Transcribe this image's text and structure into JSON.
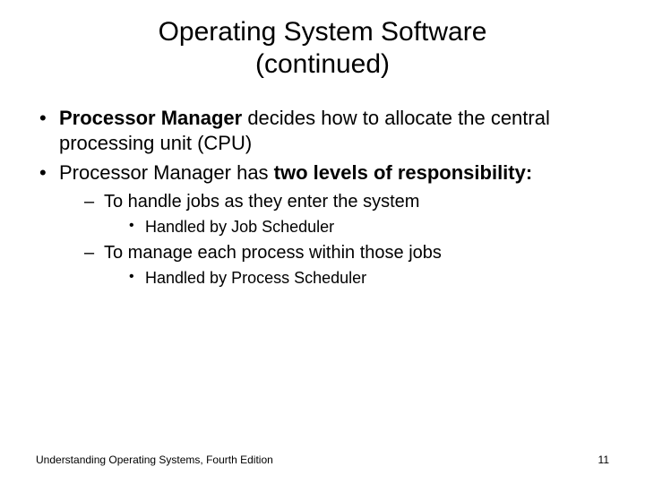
{
  "title_line1": "Operating System Software",
  "title_line2": "(continued)",
  "bullets": {
    "b1_bold": "Processor Manager",
    "b1_rest": " decides how to allocate the central processing unit (CPU)",
    "b2_pre": "Processor Manager has ",
    "b2_bold": "two levels of responsibility:",
    "b2_sub1": "To handle jobs as they enter the system",
    "b2_sub1_sub": "Handled by Job Scheduler",
    "b2_sub2": "To manage each process within those jobs",
    "b2_sub2_sub": "Handled by Process Scheduler"
  },
  "footer_left": "Understanding Operating Systems, Fourth Edition",
  "footer_right": "11"
}
